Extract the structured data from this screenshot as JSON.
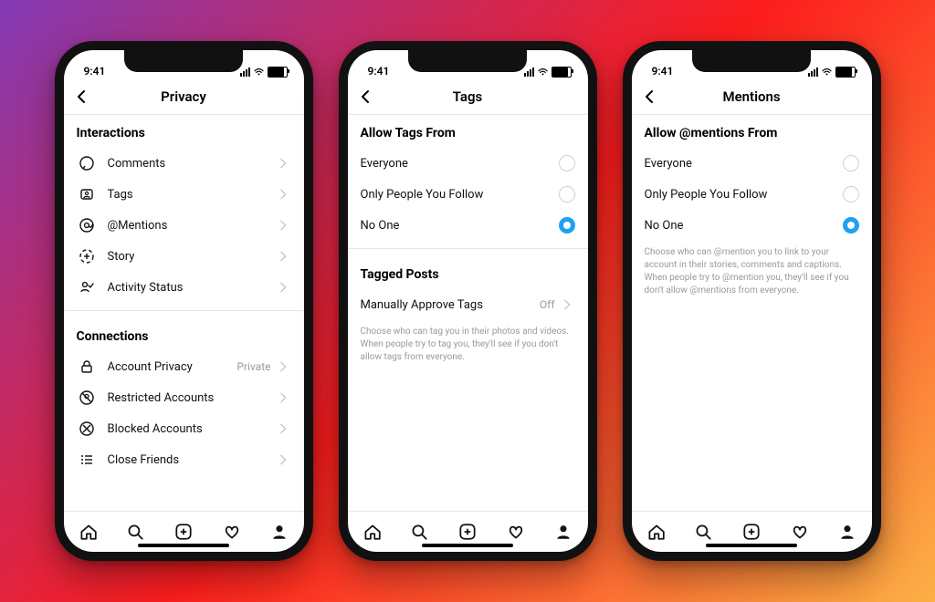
{
  "status": {
    "time": "9:41"
  },
  "phone1": {
    "header": "Privacy",
    "section1": "Interactions",
    "items1": [
      {
        "label": "Comments"
      },
      {
        "label": "Tags"
      },
      {
        "label": "@Mentions"
      },
      {
        "label": "Story"
      },
      {
        "label": "Activity Status"
      }
    ],
    "section2": "Connections",
    "items2": [
      {
        "label": "Account Privacy",
        "value": "Private"
      },
      {
        "label": "Restricted Accounts"
      },
      {
        "label": "Blocked Accounts"
      },
      {
        "label": "Close Friends"
      }
    ]
  },
  "phone2": {
    "header": "Tags",
    "section1": "Allow Tags From",
    "options": [
      {
        "label": "Everyone",
        "selected": false
      },
      {
        "label": "Only People You Follow",
        "selected": false
      },
      {
        "label": "No One",
        "selected": true
      }
    ],
    "section2": "Tagged Posts",
    "approve": {
      "label": "Manually Approve Tags",
      "value": "Off"
    },
    "help": "Choose who can tag you in their photos and videos. When people try to tag you, they'll see if you don't allow tags from everyone."
  },
  "phone3": {
    "header": "Mentions",
    "section1": "Allow @mentions From",
    "options": [
      {
        "label": "Everyone",
        "selected": false
      },
      {
        "label": "Only People You Follow",
        "selected": false
      },
      {
        "label": "No One",
        "selected": true
      }
    ],
    "help": "Choose who can @mention you to link to your account in their stories, comments and captions. When people try to @mention you, they'll see if you don't allow @mentions from everyone."
  }
}
